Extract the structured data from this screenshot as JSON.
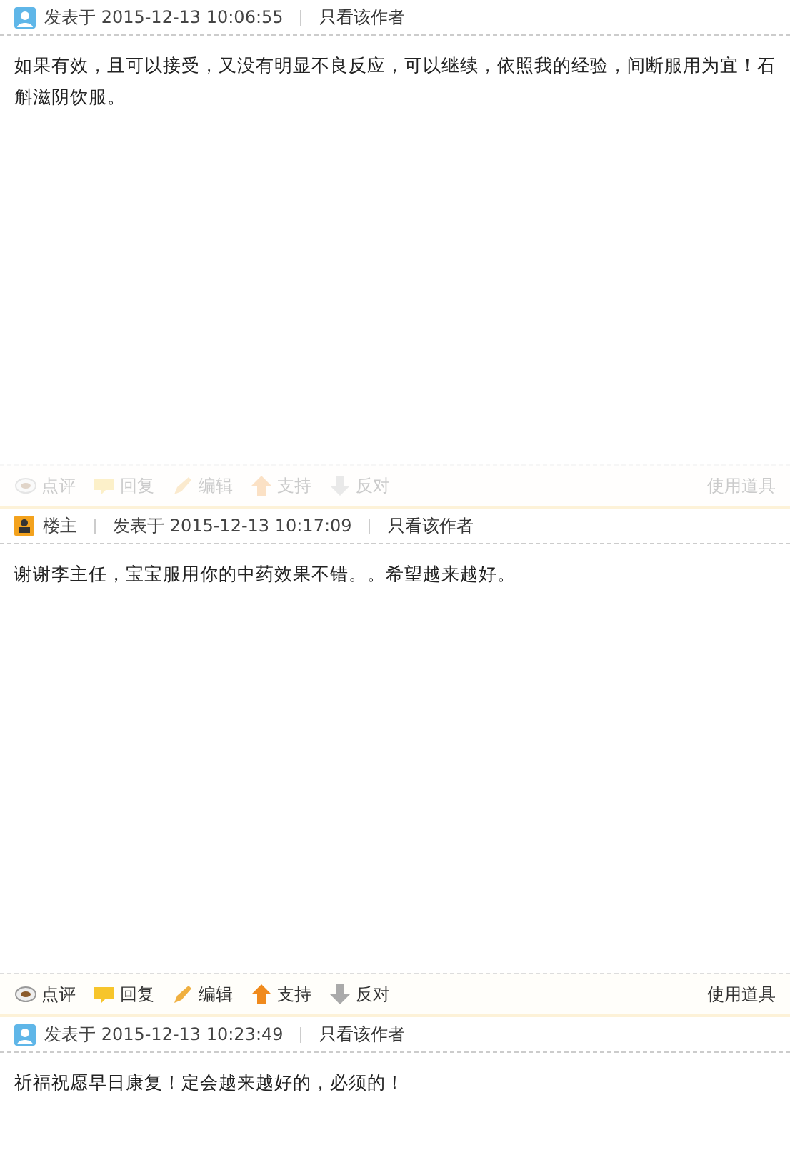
{
  "posts": [
    {
      "kind": "user",
      "posted": "发表于 2015-12-13 10:06:55",
      "only_author": "只看该作者",
      "body": "如果有效，且可以接受，又没有明显不良反应，可以继续，依照我的经验，间断服用为宜！石斛滋阴饮服。",
      "actions_dimmed": true,
      "actions": [
        "点评",
        "回复",
        "编辑",
        "支持",
        "反对"
      ],
      "tools": "使用道具"
    },
    {
      "kind": "owner",
      "author_label": "楼主",
      "posted": "发表于 2015-12-13 10:17:09",
      "only_author": "只看该作者",
      "body": "谢谢李主任，宝宝服用你的中药效果不错。。希望越来越好。",
      "actions_dimmed": false,
      "actions": [
        "点评",
        "回复",
        "编辑",
        "支持",
        "反对"
      ],
      "tools": "使用道具"
    },
    {
      "kind": "user",
      "posted": "发表于 2015-12-13 10:23:49",
      "only_author": "只看该作者",
      "body": "祈福祝愿早日康复！定会越来越好的，必须的！"
    }
  ]
}
